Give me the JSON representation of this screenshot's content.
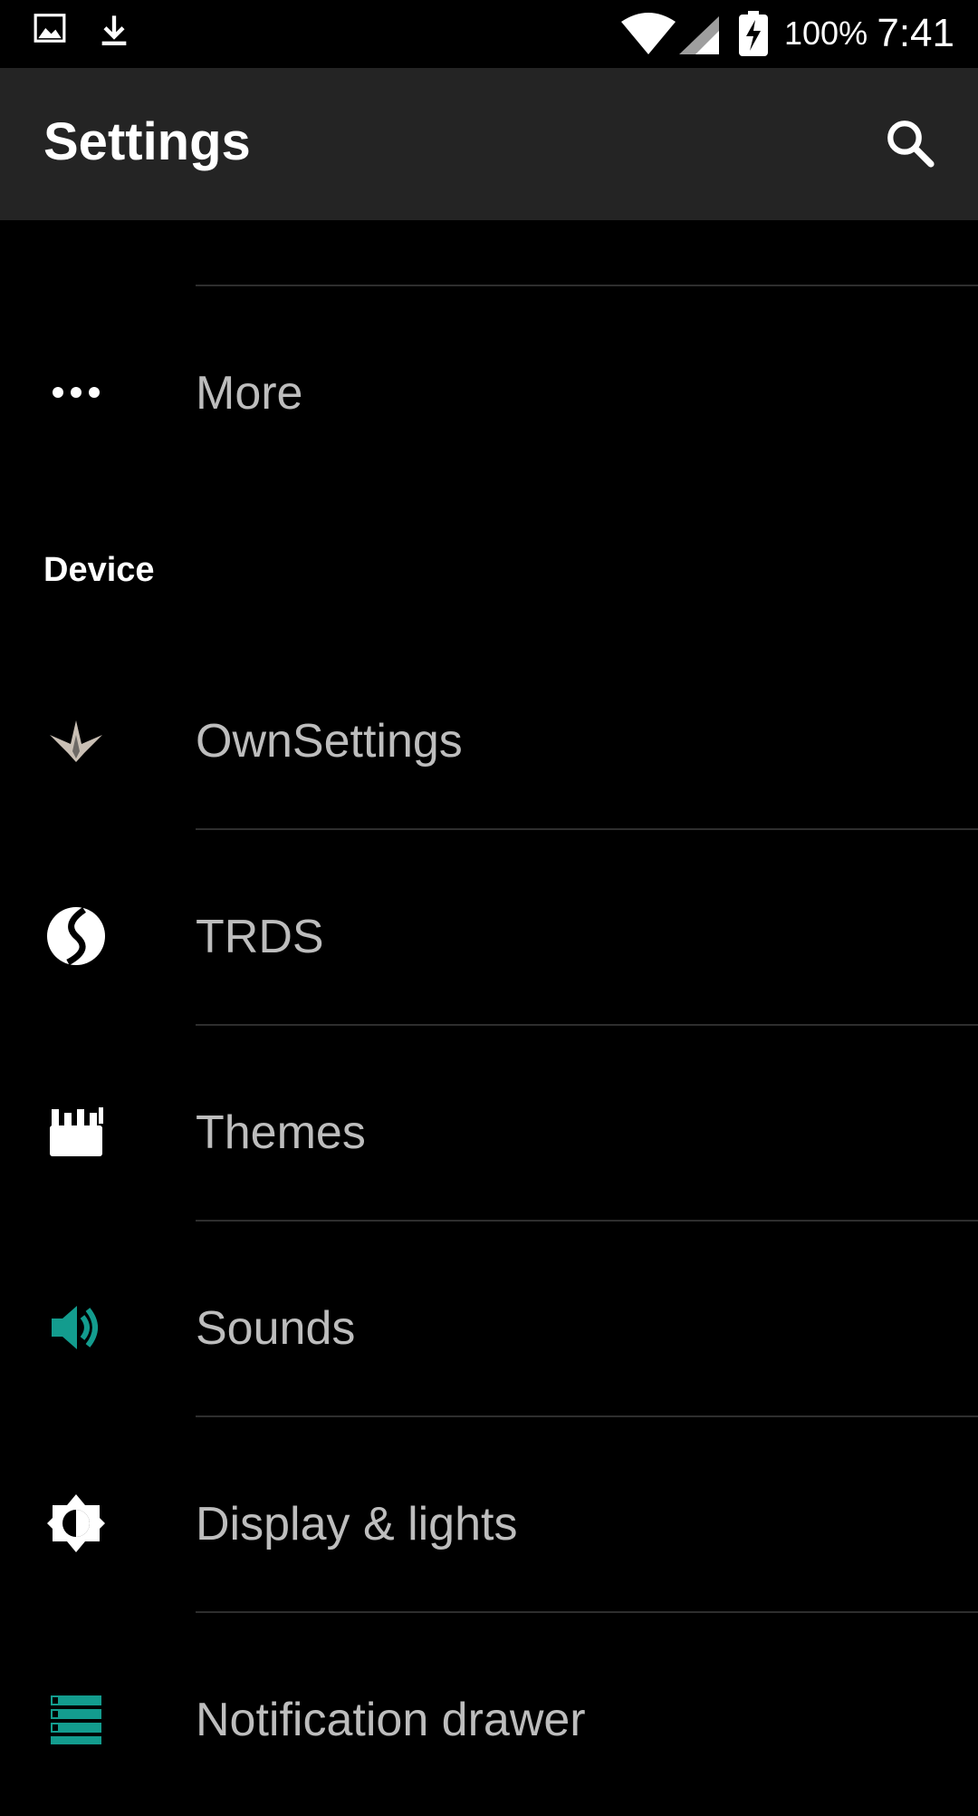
{
  "status_bar": {
    "icons": [
      "image-icon",
      "download-icon",
      "wifi-icon",
      "signal-icon",
      "battery-charging-icon"
    ],
    "battery_text": "100%",
    "time": "7:41"
  },
  "app_bar": {
    "title": "Settings",
    "search_icon": "search-icon"
  },
  "items_top": [
    {
      "label": "More",
      "icon": "more-dots-icon"
    }
  ],
  "section": {
    "title": "Device"
  },
  "device_items": [
    {
      "label": "OwnSettings",
      "icon": "ownsettings-star-icon"
    },
    {
      "label": "TRDS",
      "icon": "trds-icon"
    },
    {
      "label": "Themes",
      "icon": "themes-brush-icon"
    },
    {
      "label": "Sounds",
      "icon": "speaker-icon",
      "icon_color": "#139c8e"
    },
    {
      "label": "Display & lights",
      "icon": "brightness-icon"
    },
    {
      "label": "Notification drawer",
      "icon": "notification-drawer-icon",
      "icon_color": "#139c8e"
    }
  ],
  "colors": {
    "background": "#000000",
    "app_bar": "#242424",
    "text": "#bdbdbd",
    "accent": "#139c8e"
  }
}
